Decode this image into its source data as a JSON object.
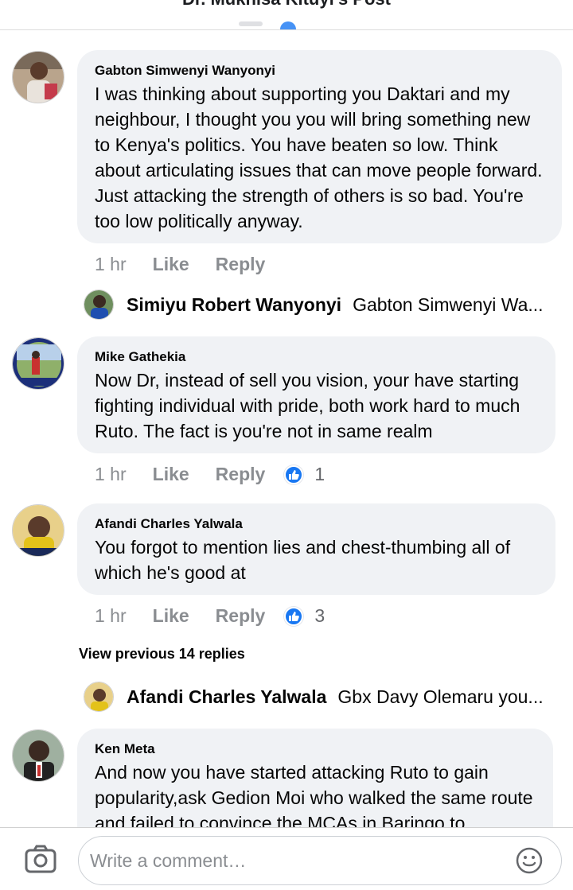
{
  "header": {
    "title": "Dr. Mukhisa Kituyi's Post"
  },
  "comments": [
    {
      "author": "Gabton Simwenyi Wanyonyi",
      "text": "I was thinking about supporting you Daktari and my neighbour, I thought you you will bring something new to Kenya's politics. You have beaten so low. Think about articulating issues that can move people forward. Just attacking the strength of others is so bad. You're too low politically anyway.",
      "time": "1 hr",
      "like": "Like",
      "reply": "Reply"
    },
    {
      "author": "Mike Gathekia",
      "text": "Now Dr, instead of sell you vision, your have starting fighting individual with pride, both work hard to much Ruto. The fact is you're not in same realm",
      "time": "1 hr",
      "like": "Like",
      "reply": "Reply",
      "reactions": "1"
    },
    {
      "author": "Afandi Charles Yalwala",
      "text": "You forgot to mention lies and chest-thumbing all of which he's good at",
      "time": "1 hr",
      "like": "Like",
      "reply": "Reply",
      "reactions": "3"
    },
    {
      "author": "Ken Meta",
      "text": "And  now you have started attacking Ruto to gain popularity,ask Gedion Moi who walked the same route and failed to convince the MCAs in Baringo to"
    }
  ],
  "replies": [
    {
      "author": "Simiyu Robert Wanyonyi",
      "preview": "Gabton Simwenyi Wa..."
    },
    {
      "author": "Afandi Charles Yalwala",
      "preview": "Gbx Davy Olemaru you..."
    }
  ],
  "view_previous": "View previous 14 replies",
  "composer": {
    "placeholder": "Write a comment…"
  },
  "colors": {
    "accent": "#1877f2",
    "bubble": "#f0f2f5",
    "meta": "#8a8d91"
  },
  "icons": [
    "camera-icon",
    "emoji-icon",
    "like-reaction-icon"
  ]
}
